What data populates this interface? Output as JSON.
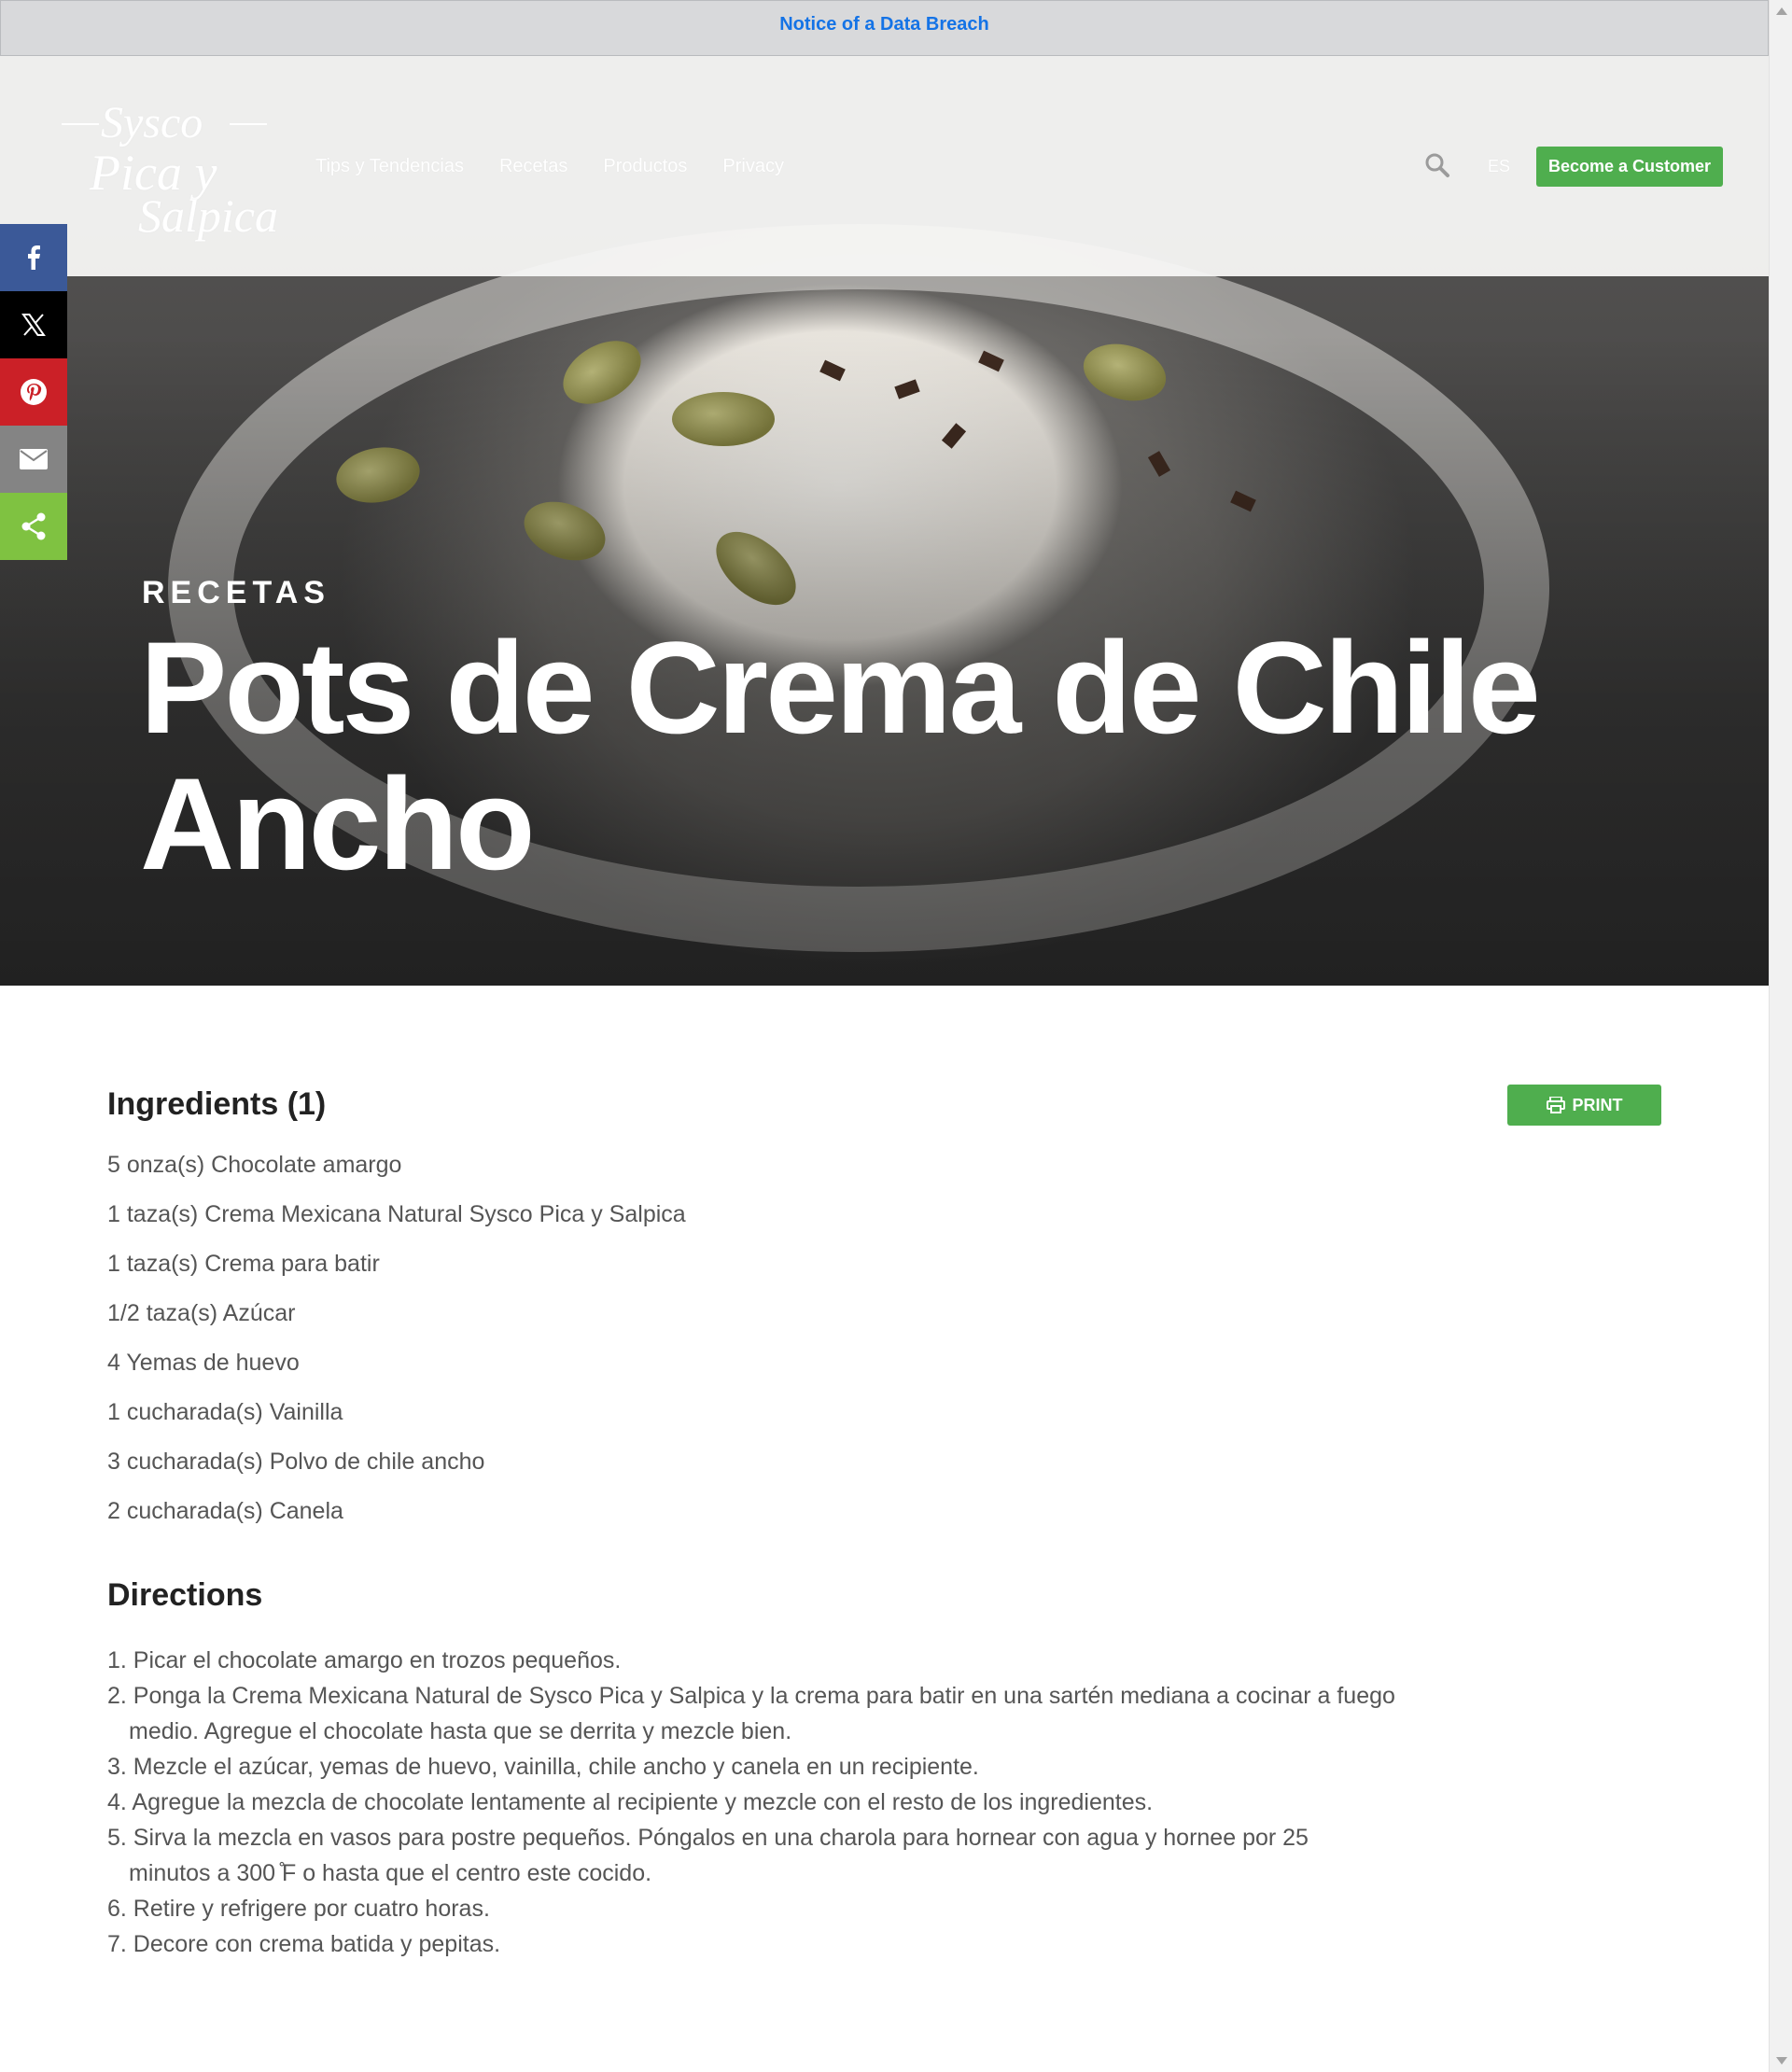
{
  "notice": {
    "text": "Notice of a Data Breach"
  },
  "header": {
    "logo": {
      "line1": "Sysco",
      "line2": "Pica y",
      "line3": "Salpica"
    },
    "nav": [
      "Tips y Tendencias",
      "Recetas",
      "Productos",
      "Privacy"
    ],
    "lang": "ES",
    "cta": "Become a Customer",
    "icons": {
      "search": "search-icon"
    }
  },
  "social": [
    "facebook-icon",
    "x-icon",
    "pinterest-icon",
    "email-icon",
    "share-icon"
  ],
  "hero": {
    "kicker": "RECETAS",
    "title": "Pots de Crema de Chile Ancho"
  },
  "recipe": {
    "ingredients_heading": "Ingredients (1)",
    "print_label": "PRINT",
    "ingredients": [
      "5 onza(s) Chocolate amargo",
      "1 taza(s) Crema Mexicana Natural Sysco Pica y Salpica",
      "1 taza(s) Crema para batir",
      "1/2 taza(s) Azúcar",
      "4 Yemas de huevo",
      "1 cucharada(s) Vainilla",
      "3 cucharada(s) Polvo de chile ancho",
      "2 cucharada(s) Canela"
    ],
    "directions_heading": "Directions",
    "directions": [
      "1. Picar el chocolate amargo en trozos pequeños.",
      "2. Ponga la Crema Mexicana Natural de Sysco Pica y Salpica y la crema para batir en una sartén mediana a cocinar a fuego medio. Agregue el chocolate hasta que se derrita y mezcle bien.",
      "3. Mezcle el azúcar, yemas de huevo, vainilla, chile ancho y canela en un recipiente.",
      "4. Agregue la mezcla de chocolate lentamente al recipiente y mezcle con el resto de los ingredientes.",
      "5. Sirva la mezcla en vasos para postre pequeños. Póngalos en una charola para hornear con agua y hornee por 25 minutos a 300 ̊F o hasta que el centro este cocido.",
      "6. Retire y refrigere por cuatro horas.",
      "7. Decore con crema batida y pepitas."
    ]
  },
  "colors": {
    "brand_green": "#4fae4e",
    "link_blue": "#1473e6",
    "facebook": "#3b5998",
    "pinterest": "#cb2027",
    "share": "#7fc241"
  }
}
